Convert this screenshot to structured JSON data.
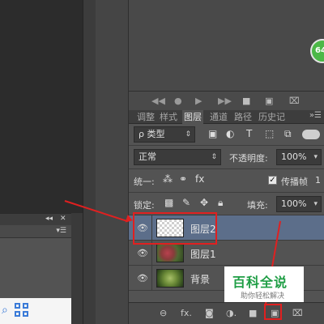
{
  "badge": {
    "value": "64"
  },
  "tabs": [
    {
      "label": "调整",
      "active": false
    },
    {
      "label": "样式",
      "active": false
    },
    {
      "label": "图层",
      "active": true
    },
    {
      "label": "通道",
      "active": false
    },
    {
      "label": "路径",
      "active": false
    },
    {
      "label": "历史记",
      "active": false
    }
  ],
  "filter": {
    "type_label": "类型",
    "search_glyph": "ρ"
  },
  "blend": {
    "mode": "正常",
    "opacity_label": "不透明度:",
    "opacity_value": "100%"
  },
  "unify": {
    "label": "统一:",
    "propagate_label": "传播帧",
    "propagate_value": "1",
    "propagate_checked": true
  },
  "lock": {
    "label": "锁定:",
    "fill_label": "填充:",
    "fill_value": "100%"
  },
  "layers": [
    {
      "name": "图层2",
      "selected": true,
      "visible": true
    },
    {
      "name": "图层1",
      "selected": false,
      "visible": true
    },
    {
      "name": "背景",
      "selected": false,
      "visible": true
    }
  ],
  "watermark": {
    "main": "百科全说",
    "sub": "助你轻松解决"
  },
  "colors": {
    "annotation": "#e02020",
    "selection": "#5c6e8a",
    "watermark_green": "#1f9e45"
  }
}
